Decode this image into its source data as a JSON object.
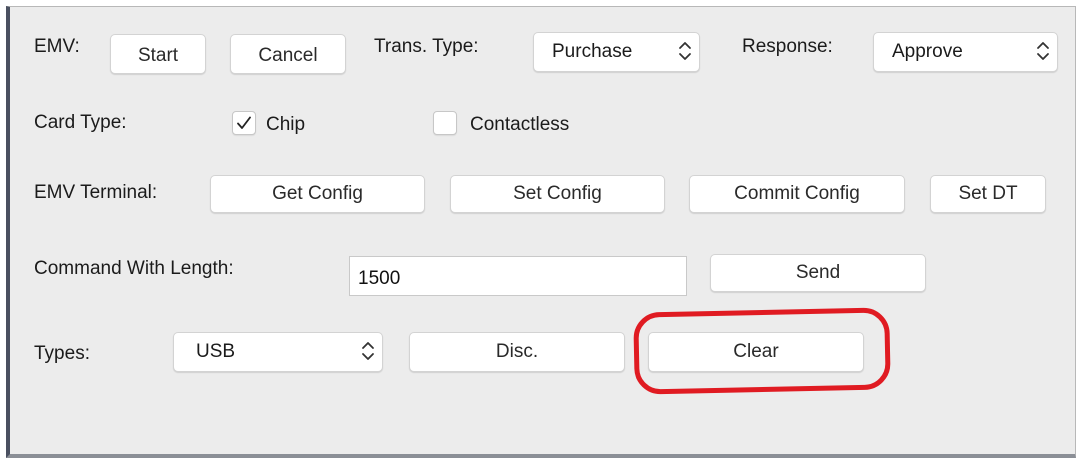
{
  "emv": {
    "label": "EMV:",
    "start_label": "Start",
    "cancel_label": "Cancel",
    "trans_type_label": "Trans. Type:",
    "trans_type_value": "Purchase",
    "response_label": "Response:",
    "response_value": "Approve"
  },
  "card_type": {
    "label": "Card Type:",
    "chip_label": "Chip",
    "chip_checked": true,
    "contactless_label": "Contactless",
    "contactless_checked": false
  },
  "emv_terminal": {
    "label": "EMV Terminal:",
    "get_config_label": "Get Config",
    "set_config_label": "Set Config",
    "commit_config_label": "Commit Config",
    "set_dt_label": "Set DT"
  },
  "command": {
    "label": "Command With Length:",
    "input_value": "1500",
    "send_label": "Send"
  },
  "types": {
    "label": "Types:",
    "select_value": "USB",
    "disc_label": "Disc.",
    "clear_label": "Clear"
  },
  "colors": {
    "annotation": "#e01b22",
    "panel_background": "#ececec",
    "button_background": "#ffffff"
  }
}
